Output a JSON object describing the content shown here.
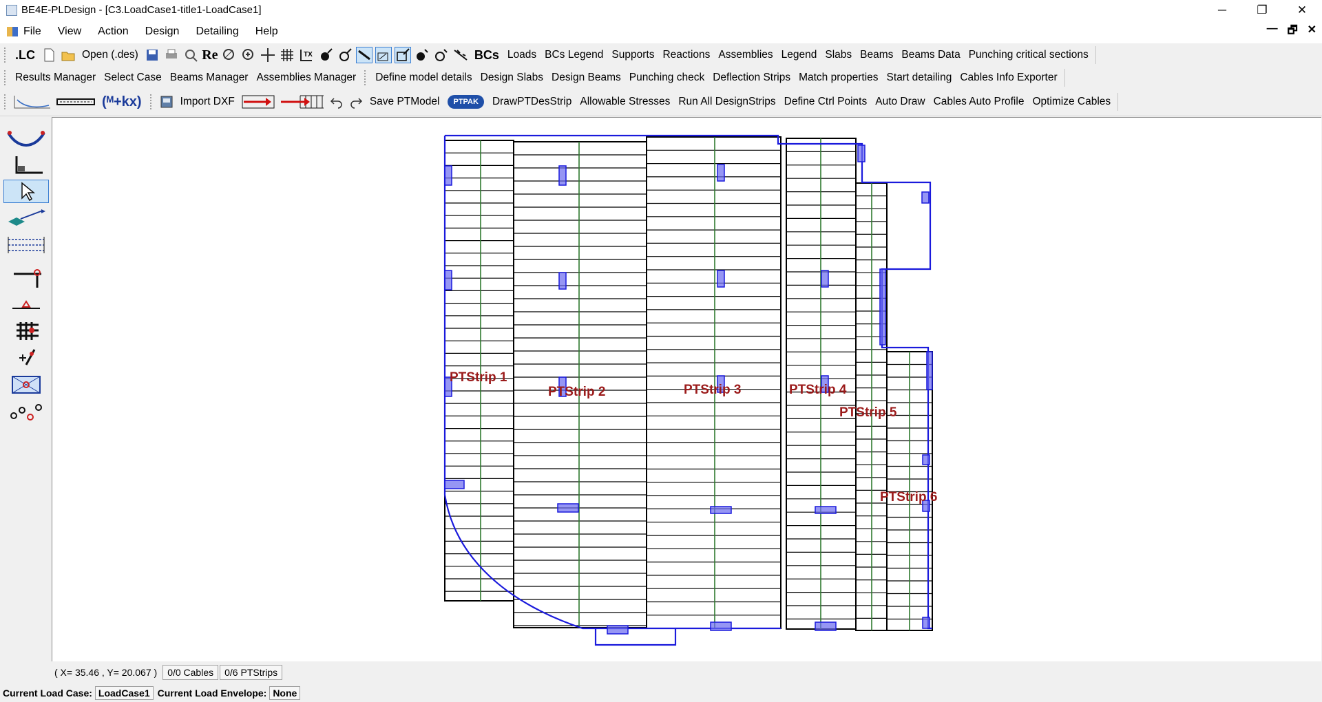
{
  "window": {
    "title": "BE4E-PLDesign - [C3.LoadCase1-title1-LoadCase1]",
    "min": "─",
    "max": "❐",
    "close": "✕"
  },
  "menu": {
    "items": [
      "File",
      "View",
      "Action",
      "Design",
      "Detailing",
      "Help"
    ],
    "mdi_min": "—",
    "mdi_restore": "🗗",
    "mdi_close": "✕"
  },
  "toolbar1": {
    "lc": ".LC",
    "open": "Open (.des)",
    "re": "Re",
    "bcs": "BCs",
    "buttons": [
      "Loads",
      "BCs Legend",
      "Supports",
      "Reactions",
      "Assemblies",
      "Legend",
      "Slabs",
      "Beams",
      "Beams Data",
      "Punching critical sections"
    ]
  },
  "toolbar2": {
    "buttons": [
      "Results Manager",
      "Select Case",
      "Beams Manager",
      "Assemblies Manager",
      "Define model details",
      "Design Slabs",
      "Design Beams",
      "Punching check",
      "Deflection Strips",
      "Match properties",
      "Start detailing",
      "Cables Info Exporter"
    ]
  },
  "toolbar3": {
    "formula": "(ᴹ+kx)",
    "import_dxf": "Import DXF",
    "save_ptmodel": "Save PTModel",
    "ptpak": "PTPAK",
    "buttons": [
      "DrawPTDesStrip",
      "Allowable Stresses",
      "Run All DesignStrips",
      "Define Ctrl Points",
      "Auto Draw",
      "Cables Auto Profile",
      "Optimize Cables"
    ]
  },
  "canvas": {
    "strips": [
      {
        "label": "PTStrip 1"
      },
      {
        "label": "PTStrip 2"
      },
      {
        "label": "PTStrip 3"
      },
      {
        "label": "PTStrip 4"
      },
      {
        "label": "PTStrip 5"
      },
      {
        "label": "PTStrip 6"
      }
    ],
    "colors": {
      "outline": "#1a1adc",
      "strip_line": "#000000",
      "centerline": "#2f7a2f",
      "support": "#6a6af0",
      "label": "#9b1b1b"
    }
  },
  "status": {
    "coords": "( X= 35.46 , Y= 20.067 )",
    "cables": "0/0 Cables",
    "strips": "0/6 PTStrips"
  },
  "loadbar": {
    "case_label": "Current Load Case:",
    "case_value": "LoadCase1",
    "env_label": "Current Load Envelope:",
    "env_value": "None"
  }
}
